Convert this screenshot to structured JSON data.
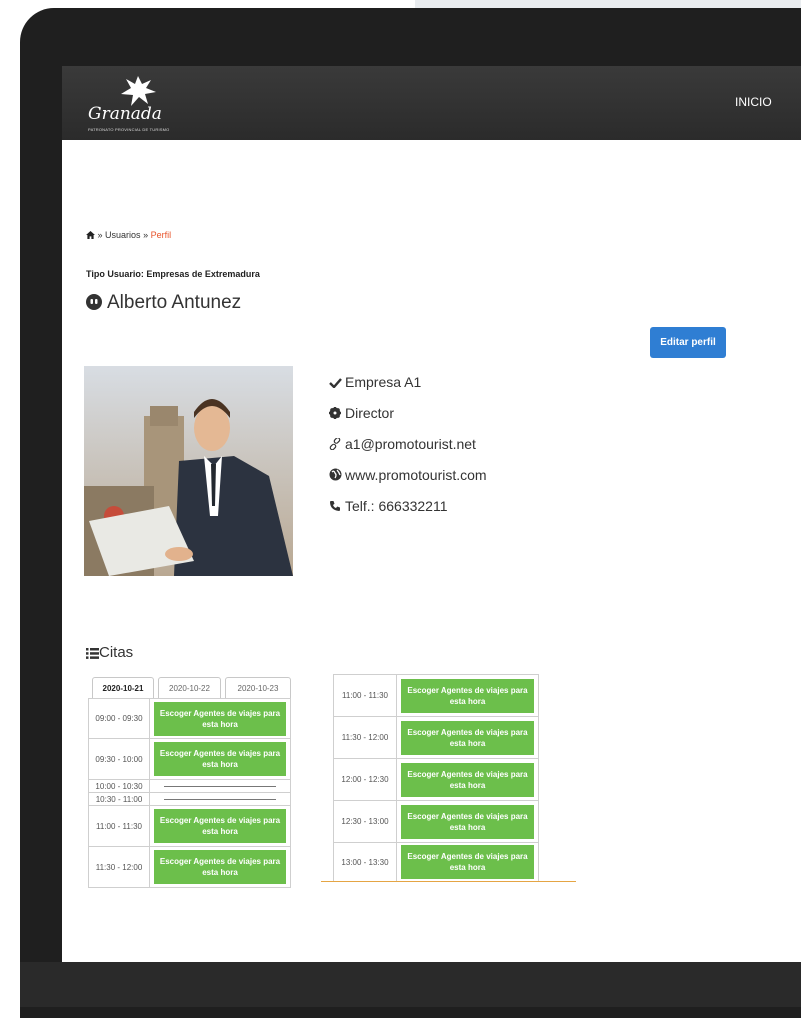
{
  "nav": {
    "logo_text": "Granada",
    "logo_tagline": "PATRONATO PROVINCIAL DE TURISMO",
    "links": [
      "INICIO"
    ]
  },
  "breadcrumb": {
    "home_icon": "home-icon",
    "sep": "»",
    "items": [
      "Usuarios",
      "Perfil"
    ]
  },
  "profile": {
    "tipo_usuario": "Tipo Usuario: Empresas de Extremadura",
    "name": "Alberto Antunez",
    "edit_button": "Editar perfil",
    "info": [
      {
        "icon": "check-icon",
        "text": "Empresa A1"
      },
      {
        "icon": "gear-icon",
        "text": "Director"
      },
      {
        "icon": "link-icon",
        "text": "a1@promotourist.net"
      },
      {
        "icon": "globe-icon",
        "text": "www.promotourist.com"
      },
      {
        "icon": "phone-icon",
        "text": "Telf.: 666332211"
      }
    ]
  },
  "citas": {
    "title": "Citas",
    "tabs": [
      "2020-10-21",
      "2020-10-22",
      "2020-10-23"
    ],
    "active_tab": "2020-10-21",
    "button_label": "Escoger Agentes de viajes para esta hora",
    "slots_left": [
      {
        "time": "09:00 - 09:30",
        "available": true
      },
      {
        "time": "09:30 - 10:00",
        "available": true
      },
      {
        "time": "10:00 - 10:30",
        "available": false
      },
      {
        "time": "10:30 - 11:00",
        "available": false
      },
      {
        "time": "11:00 - 11:30",
        "available": true
      },
      {
        "time": "11:30 - 12:00",
        "available": true
      }
    ],
    "slots_right": [
      {
        "time": "11:00 - 11:30",
        "available": true
      },
      {
        "time": "11:30 - 12:00",
        "available": true
      },
      {
        "time": "12:00 - 12:30",
        "available": true
      },
      {
        "time": "12:30 - 13:00",
        "available": true
      },
      {
        "time": "13:00 - 13:30",
        "available": true
      }
    ]
  },
  "colors": {
    "nav_bg": "#2d2d2d",
    "accent_orange": "#e8542b",
    "primary_blue": "#2f7ed3",
    "slot_green": "#6cbf4b"
  }
}
